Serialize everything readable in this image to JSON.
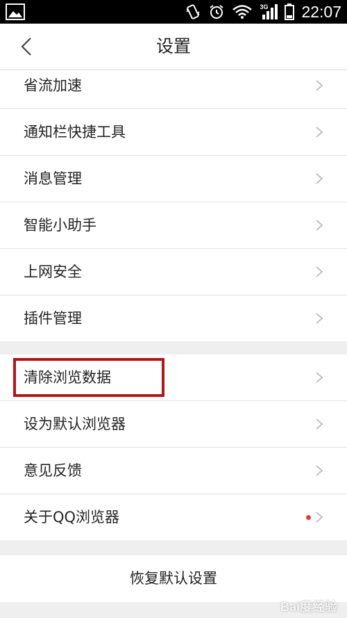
{
  "status_bar": {
    "time": "22:07",
    "network": "3G",
    "icons": [
      "image-icon",
      "vibrate-icon",
      "alarm-icon",
      "wifi-icon",
      "signal-icon",
      "battery-icon"
    ]
  },
  "header": {
    "title": "设置",
    "back_icon": "back-chevron-icon"
  },
  "groups": [
    {
      "items": [
        {
          "label": "省流加速"
        },
        {
          "label": "通知栏快捷工具"
        },
        {
          "label": "消息管理"
        },
        {
          "label": "智能小助手"
        },
        {
          "label": "上网安全"
        },
        {
          "label": "插件管理"
        }
      ]
    },
    {
      "items": [
        {
          "label": "清除浏览数据",
          "highlighted": true
        },
        {
          "label": "设为默认浏览器"
        },
        {
          "label": "意见反馈"
        },
        {
          "label": "关于QQ浏览器",
          "badge": "red-dot"
        }
      ]
    }
  ],
  "restore_button": {
    "label": "恢复默认设置"
  },
  "watermark": {
    "text": "Bai度经验"
  },
  "colors": {
    "highlight_border": "#b0161c",
    "badge_dot": "#e5393a",
    "status_bar_bg": "#000000",
    "page_bg": "#efefef"
  }
}
